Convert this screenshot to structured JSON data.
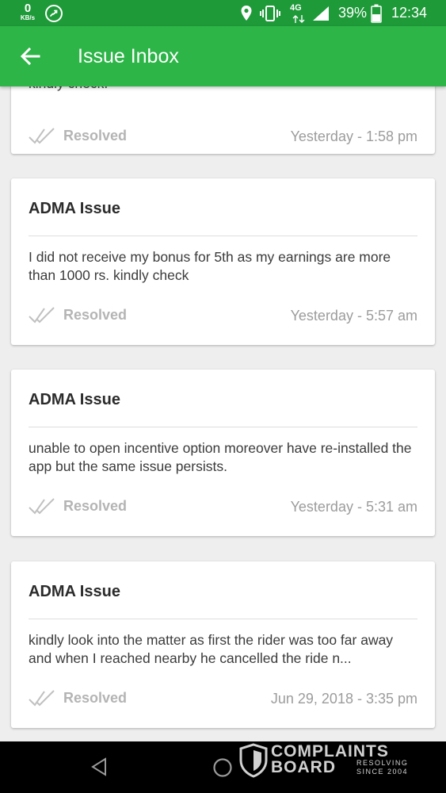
{
  "status_bar": {
    "network_speed_value": "0",
    "network_speed_unit": "KB/s",
    "network_type": "4G",
    "battery_percent": "39%",
    "time": "12:34"
  },
  "app_bar": {
    "title": "Issue Inbox"
  },
  "issues": [
    {
      "title": "",
      "message": "kindly check.",
      "status": "Resolved",
      "timestamp": "Yesterday - 1:58 pm"
    },
    {
      "title": "ADMA Issue",
      "message": "I did not receive my bonus for 5th as my earnings are more than 1000 rs. kindly check",
      "status": "Resolved",
      "timestamp": "Yesterday - 5:57 am"
    },
    {
      "title": "ADMA Issue",
      "message": "unable to open incentive option moreover have re-installed the app but the same issue persists.",
      "status": "Resolved",
      "timestamp": "Yesterday - 5:31 am"
    },
    {
      "title": "ADMA Issue",
      "message": "kindly look into the matter as first the rider was too far away and when I reached nearby he cancelled the ride n...",
      "status": "Resolved",
      "timestamp": "Jun 29, 2018 - 3:35 pm"
    }
  ],
  "watermark": {
    "line1": "COMPLAINTS",
    "line2": "BOARD",
    "sub1": "RESOLVING",
    "sub2": "SINCE 2004"
  },
  "colors": {
    "status_bar": "#1e9a39",
    "app_bar": "#2db548",
    "background": "#eeeeee",
    "resolved_text": "#b4b4b4"
  }
}
